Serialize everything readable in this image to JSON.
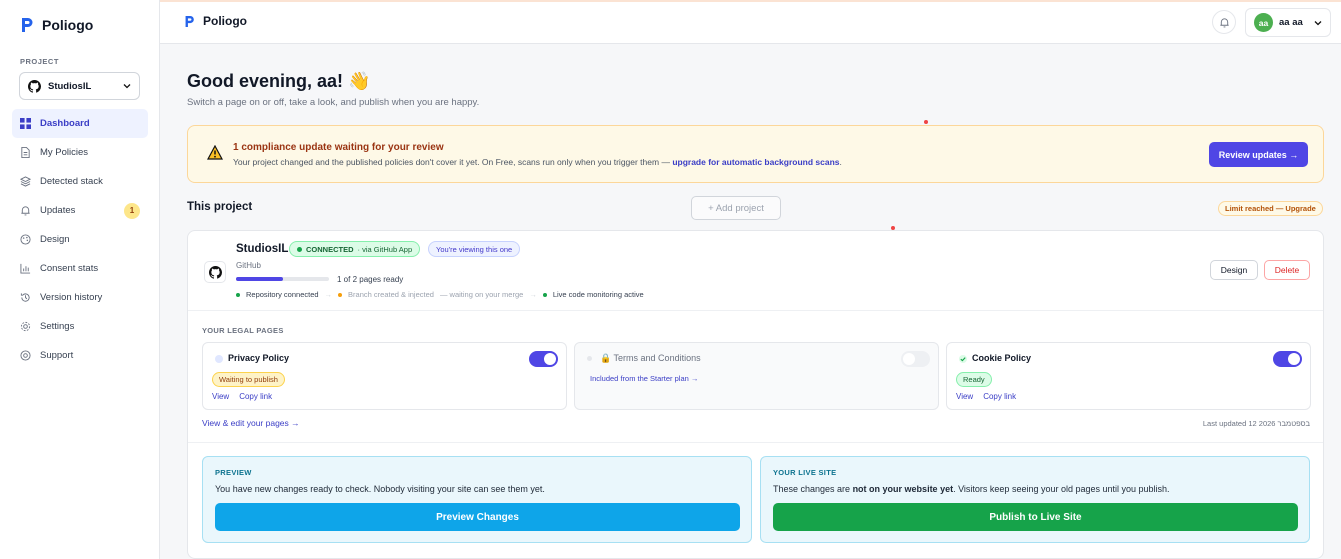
{
  "app": {
    "name": "Poliogo"
  },
  "sidebar": {
    "project_label": "PROJECT",
    "project_name": "StudiosIL",
    "items": [
      {
        "label": "Dashboard",
        "icon": "dashboard-icon",
        "active": true
      },
      {
        "label": "My Policies",
        "icon": "document-icon"
      },
      {
        "label": "Detected stack",
        "icon": "layers-icon"
      },
      {
        "label": "Updates",
        "icon": "bell-icon",
        "badge": "1"
      },
      {
        "label": "Design",
        "icon": "palette-icon"
      },
      {
        "label": "Consent stats",
        "icon": "chart-icon"
      },
      {
        "label": "Version history",
        "icon": "history-icon"
      },
      {
        "label": "Settings",
        "icon": "gear-icon"
      },
      {
        "label": "Support",
        "icon": "support-icon"
      }
    ]
  },
  "topbar": {
    "user_initials": "aa",
    "user_name": "aa aa"
  },
  "header": {
    "greeting": "Good evening, aa! 👋",
    "subtitle": "Switch a page on or off, take a look, and publish when you are happy."
  },
  "alert": {
    "title": "1 compliance update waiting for your review",
    "text": "Your project changed and the published policies don't cover it yet. On Free, scans run only when you trigger them — ",
    "link": "upgrade for automatic background scans",
    "text_end": ".",
    "button": "Review updates →",
    "colors": {
      "bg": "#fef9e7",
      "title": "#9a3412"
    }
  },
  "section": {
    "title": "This project",
    "add_project": "+ Add project",
    "limit": "Limit reached — Upgrade"
  },
  "project": {
    "name": "StudiosIL",
    "connected_label": "CONNECTED",
    "connected_via": "· via GitHub App",
    "viewing": "You're viewing this one",
    "source": "GitHub",
    "progress_fraction": 0.5,
    "progress_text": "1 of 2 pages ready",
    "steps": [
      {
        "label": "Repository connected",
        "color": "#16a34a",
        "muted": false
      },
      {
        "label": "Branch created & injected",
        "note": "— waiting on your merge",
        "color": "#f59e0b",
        "muted": true
      },
      {
        "label": "Live code monitoring active",
        "color": "#16a34a",
        "muted": false
      }
    ],
    "design_button": "Design",
    "delete_button": "Delete"
  },
  "legal_pages": {
    "label": "YOUR LEGAL PAGES",
    "pages": [
      {
        "title": "Privacy Policy",
        "on": true,
        "status": "Waiting to publish",
        "view": "View",
        "copy": "Copy link"
      },
      {
        "title": "🔒 Terms and Conditions",
        "on": false,
        "included": "Included from the Starter plan →"
      },
      {
        "title": "Cookie Policy",
        "on": true,
        "status": "Ready",
        "view": "View",
        "copy": "Copy link"
      }
    ],
    "view_edit": "View & edit your pages →",
    "last_updated": "Last updated 12 בספטמבר 2026"
  },
  "publish": {
    "preview": {
      "label": "PREVIEW",
      "text": "You have new changes ready to check. Nobody visiting your site can see them yet.",
      "button": "Preview Changes",
      "color": "#0ea5e9"
    },
    "live": {
      "label": "YOUR LIVE SITE",
      "text_a": "These changes are ",
      "text_b": "not on your website yet",
      "text_c": ". Visitors keep seeing your old pages until you publish.",
      "button": "Publish to Live Site",
      "color": "#16a34a"
    }
  }
}
